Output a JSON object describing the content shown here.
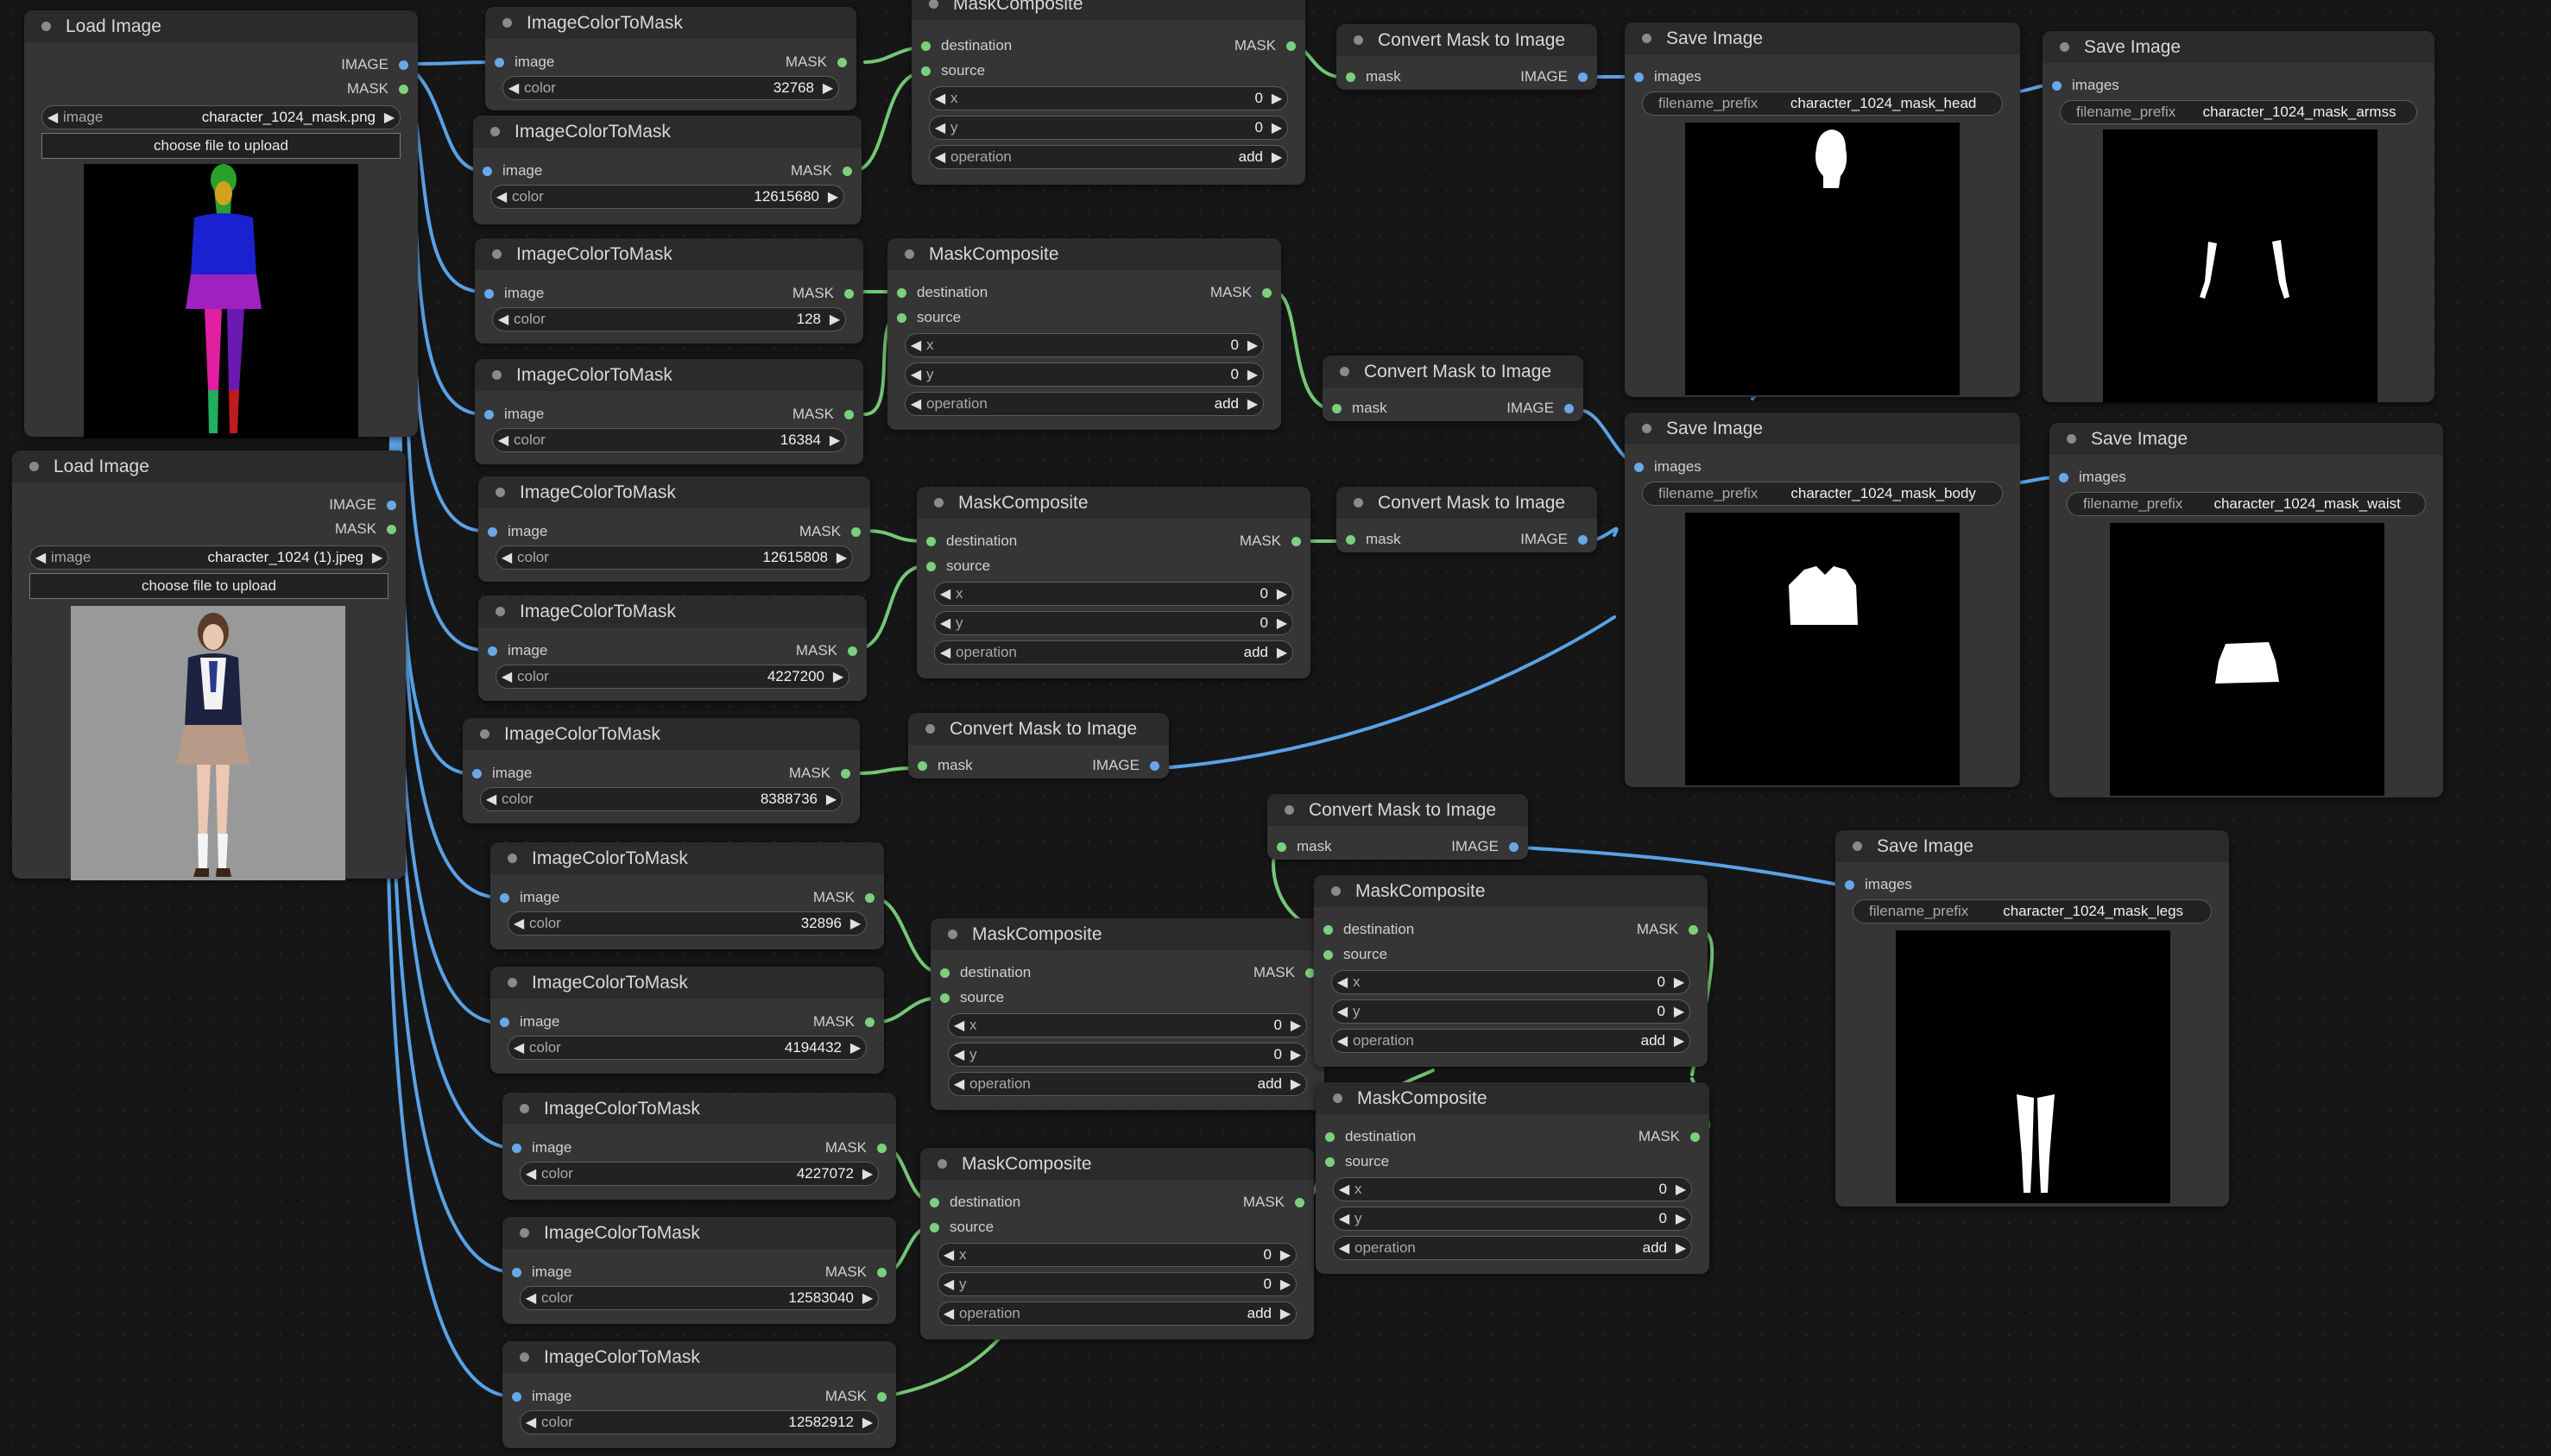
{
  "accent": {
    "image_wire": "#5aa2e6",
    "mask_wire": "#74c874",
    "canvas_bg": "#161616",
    "node_bg": "#353535"
  },
  "load_image_1": {
    "title": "Load Image",
    "out_image": "IMAGE",
    "out_mask": "MASK",
    "image_label": "image",
    "image_value": "character_1024_mask.png",
    "upload_label": "choose file to upload",
    "preview_colors": {
      "hair": "#2aa02a",
      "face": "#d4a020",
      "shirt": "#1a22d0",
      "skirt": "#a020c0",
      "leg_left": "#e020a0",
      "leg_right": "#6a1ab0",
      "sock_left": "#20b060",
      "sock_right": "#c01a20"
    }
  },
  "load_image_2": {
    "title": "Load Image",
    "out_image": "IMAGE",
    "out_mask": "MASK",
    "image_label": "image",
    "image_value": "character_1024 (1).jpeg",
    "upload_label": "choose file to upload"
  },
  "color_to_mask": [
    {
      "title": "ImageColorToMask",
      "in": "image",
      "out": "MASK",
      "color_label": "color",
      "color": "32768"
    },
    {
      "title": "ImageColorToMask",
      "in": "image",
      "out": "MASK",
      "color_label": "color",
      "color": "12615680"
    },
    {
      "title": "ImageColorToMask",
      "in": "image",
      "out": "MASK",
      "color_label": "color",
      "color": "128"
    },
    {
      "title": "ImageColorToMask",
      "in": "image",
      "out": "MASK",
      "color_label": "color",
      "color": "16384"
    },
    {
      "title": "ImageColorToMask",
      "in": "image",
      "out": "MASK",
      "color_label": "color",
      "color": "12615808"
    },
    {
      "title": "ImageColorToMask",
      "in": "image",
      "out": "MASK",
      "color_label": "color",
      "color": "4227200"
    },
    {
      "title": "ImageColorToMask",
      "in": "image",
      "out": "MASK",
      "color_label": "color",
      "color": "8388736"
    },
    {
      "title": "ImageColorToMask",
      "in": "image",
      "out": "MASK",
      "color_label": "color",
      "color": "32896"
    },
    {
      "title": "ImageColorToMask",
      "in": "image",
      "out": "MASK",
      "color_label": "color",
      "color": "4194432"
    },
    {
      "title": "ImageColorToMask",
      "in": "image",
      "out": "MASK",
      "color_label": "color",
      "color": "4227072"
    },
    {
      "title": "ImageColorToMask",
      "in": "image",
      "out": "MASK",
      "color_label": "color",
      "color": "12583040"
    },
    {
      "title": "ImageColorToMask",
      "in": "image",
      "out": "MASK",
      "color_label": "color",
      "color": "12582912"
    }
  ],
  "mask_composite": [
    {
      "title": "MaskComposite",
      "in_dest": "destination",
      "in_src": "source",
      "out": "MASK",
      "x_label": "x",
      "x": "0",
      "y_label": "y",
      "y": "0",
      "op_label": "operation",
      "op": "add"
    },
    {
      "title": "MaskComposite",
      "in_dest": "destination",
      "in_src": "source",
      "out": "MASK",
      "x_label": "x",
      "x": "0",
      "y_label": "y",
      "y": "0",
      "op_label": "operation",
      "op": "add"
    },
    {
      "title": "MaskComposite",
      "in_dest": "destination",
      "in_src": "source",
      "out": "MASK",
      "x_label": "x",
      "x": "0",
      "y_label": "y",
      "y": "0",
      "op_label": "operation",
      "op": "add"
    },
    {
      "title": "MaskComposite",
      "in_dest": "destination",
      "in_src": "source",
      "out": "MASK",
      "x_label": "x",
      "x": "0",
      "y_label": "y",
      "y": "0",
      "op_label": "operation",
      "op": "add"
    },
    {
      "title": "MaskComposite",
      "in_dest": "destination",
      "in_src": "source",
      "out": "MASK",
      "x_label": "x",
      "x": "0",
      "y_label": "y",
      "y": "0",
      "op_label": "operation",
      "op": "add"
    },
    {
      "title": "MaskComposite",
      "in_dest": "destination",
      "in_src": "source",
      "out": "MASK",
      "x_label": "x",
      "x": "0",
      "y_label": "y",
      "y": "0",
      "op_label": "operation",
      "op": "add"
    },
    {
      "title": "MaskComposite",
      "in_dest": "destination",
      "in_src": "source",
      "out": "MASK",
      "x_label": "x",
      "x": "0",
      "y_label": "y",
      "y": "0",
      "op_label": "operation",
      "op": "add"
    }
  ],
  "convert_mask": [
    {
      "title": "Convert Mask to Image",
      "in": "mask",
      "out": "IMAGE"
    },
    {
      "title": "Convert Mask to Image",
      "in": "mask",
      "out": "IMAGE"
    },
    {
      "title": "Convert Mask to Image",
      "in": "mask",
      "out": "IMAGE"
    },
    {
      "title": "Convert Mask to Image",
      "in": "mask",
      "out": "IMAGE"
    },
    {
      "title": "Convert Mask to Image",
      "in": "mask",
      "out": "IMAGE"
    }
  ],
  "save_image": [
    {
      "title": "Save Image",
      "in": "images",
      "prefix_label": "filename_prefix",
      "prefix": "character_1024_mask_head"
    },
    {
      "title": "Save Image",
      "in": "images",
      "prefix_label": "filename_prefix",
      "prefix": "character_1024_mask_armss"
    },
    {
      "title": "Save Image",
      "in": "images",
      "prefix_label": "filename_prefix",
      "prefix": "character_1024_mask_body"
    },
    {
      "title": "Save Image",
      "in": "images",
      "prefix_label": "filename_prefix",
      "prefix": "character_1024_mask_waist"
    },
    {
      "title": "Save Image",
      "in": "images",
      "prefix_label": "filename_prefix",
      "prefix": "character_1024_mask_legs"
    }
  ]
}
